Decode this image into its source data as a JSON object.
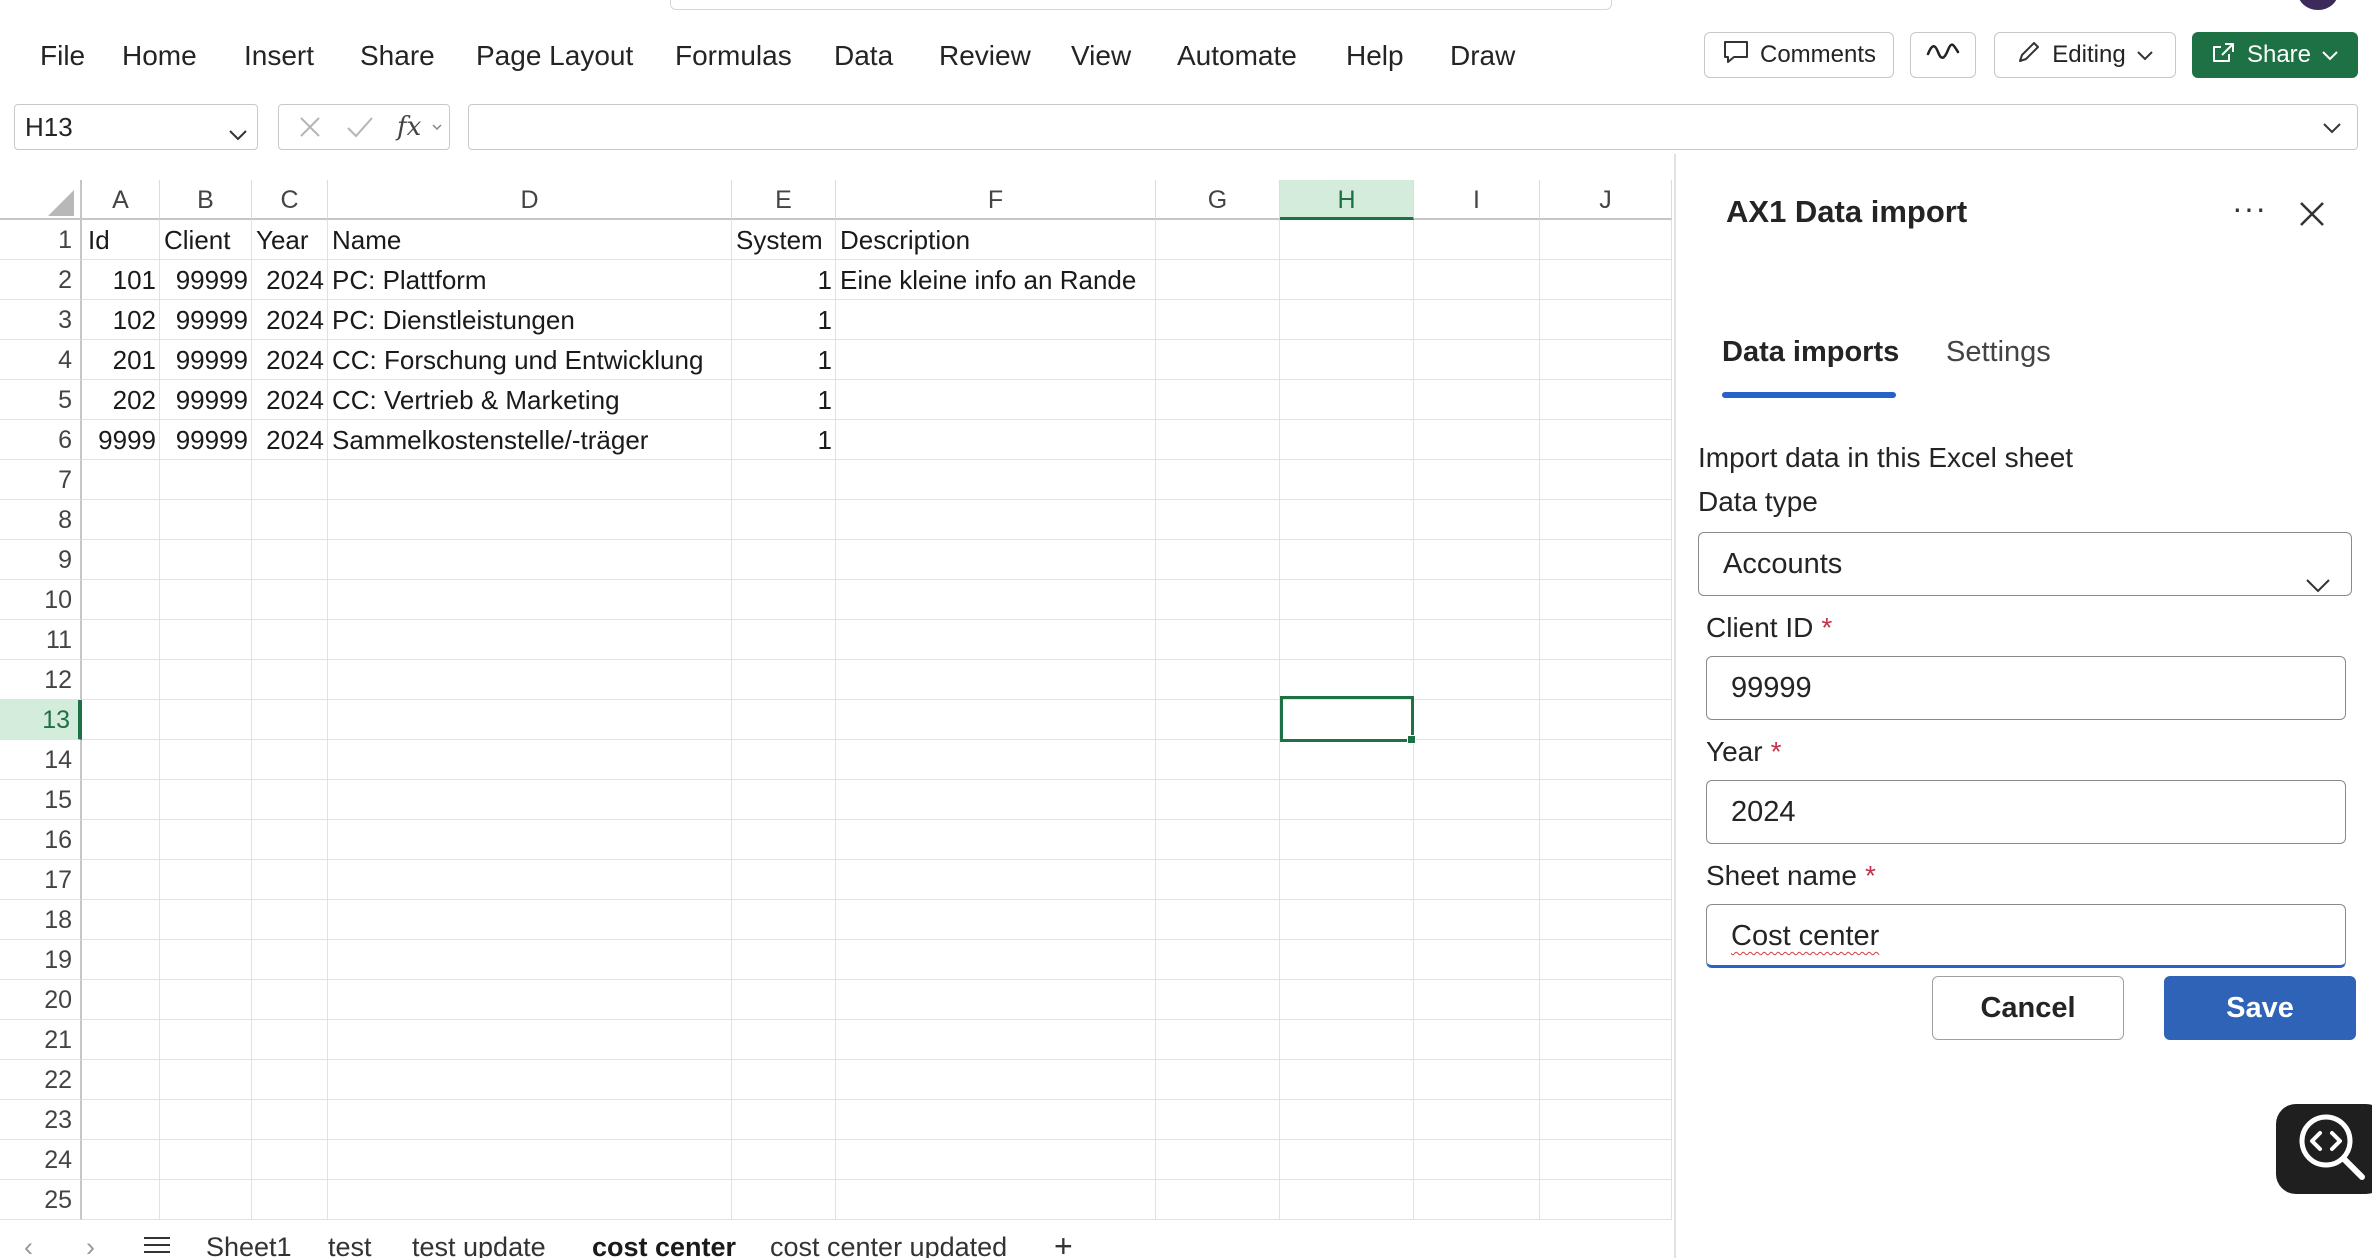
{
  "menu": {
    "items": [
      "File",
      "Home",
      "Insert",
      "Share",
      "Page Layout",
      "Formulas",
      "Data",
      "Review",
      "View",
      "Automate",
      "Help",
      "Draw"
    ]
  },
  "toolbar": {
    "comments_label": "Comments",
    "editing_label": "Editing",
    "share_label": "Share"
  },
  "formula_bar": {
    "name_box": "H13",
    "fx_symbol": "fx",
    "value": ""
  },
  "grid": {
    "columns": [
      "A",
      "B",
      "C",
      "D",
      "E",
      "F",
      "G",
      "H",
      "I",
      "J"
    ],
    "selected_column": "H",
    "selected_row": 13,
    "rows": [
      1,
      2,
      3,
      4,
      5,
      6,
      7,
      8,
      9,
      10,
      11,
      12,
      13,
      14,
      15,
      16,
      17,
      18,
      19,
      20,
      21,
      22,
      23,
      24,
      25
    ],
    "header": {
      "id": "Id",
      "client": "Client",
      "year": "Year",
      "name": "Name",
      "system": "System",
      "description": "Description"
    },
    "data": [
      {
        "id": "101",
        "client": "99999",
        "year": "2024",
        "name": "PC: Plattform",
        "system": "1",
        "description": "Eine kleine info an Rande"
      },
      {
        "id": "102",
        "client": "99999",
        "year": "2024",
        "name": "PC: Dienstleistungen",
        "system": "1",
        "description": ""
      },
      {
        "id": "201",
        "client": "99999",
        "year": "2024",
        "name": "CC: Forschung und Entwicklung",
        "system": "1",
        "description": ""
      },
      {
        "id": "202",
        "client": "99999",
        "year": "2024",
        "name": "CC: Vertrieb & Marketing",
        "system": "1",
        "description": ""
      },
      {
        "id": "9999",
        "client": "99999",
        "year": "2024",
        "name": "Sammelkostenstelle/-träger",
        "system": "1",
        "description": ""
      }
    ]
  },
  "sheet_tabs": {
    "tabs": [
      "Sheet1",
      "test",
      "test update",
      "cost center",
      "cost center updated"
    ],
    "active": "cost center",
    "add_label": "+"
  },
  "pane": {
    "title": "AX1 Data import",
    "more_label": "···",
    "tabs": [
      {
        "label": "Data imports"
      },
      {
        "label": "Settings"
      }
    ],
    "active_tab": "Data imports",
    "intro": "Import data in this Excel sheet",
    "data_type": {
      "label": "Data type",
      "value": "Accounts"
    },
    "client_id": {
      "label": "Client ID",
      "required": "*",
      "value": "99999"
    },
    "year": {
      "label": "Year",
      "required": "*",
      "value": "2024"
    },
    "sheet_name": {
      "label": "Sheet name",
      "required": "*",
      "value": "Cost center"
    },
    "cancel_label": "Cancel",
    "save_label": "Save"
  },
  "colors": {
    "excel_green": "#1e7145",
    "accent_blue": "#2e63b8",
    "required_red": "#c4314b"
  },
  "icons": [
    "comment-icon",
    "activity-icon",
    "pencil-icon",
    "share-icon",
    "chevron-down-icon",
    "cancel-x-icon",
    "check-icon",
    "fx-icon",
    "close-icon",
    "more-icon",
    "code-search-icon"
  ]
}
